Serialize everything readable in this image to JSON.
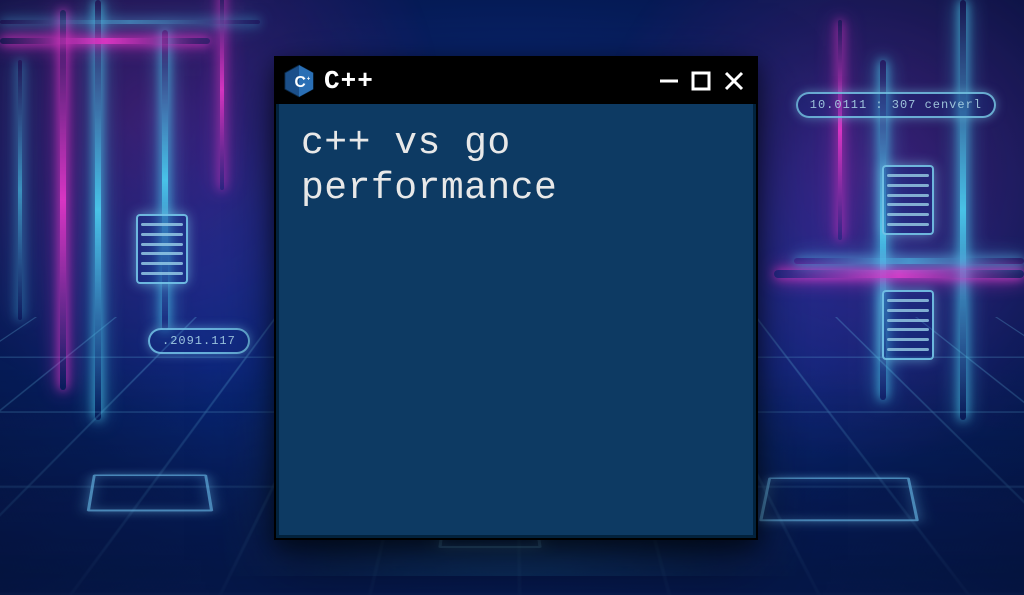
{
  "window": {
    "title": "C++",
    "body_text": "c++ vs go performance"
  },
  "decor": {
    "pill_left": ".2091.117",
    "pill_right": "10.0111 : 307  cenverl"
  },
  "colors": {
    "window_bg": "#0d3a63",
    "titlebar_bg": "#000000",
    "text": "#e8e8e8",
    "neon_cyan": "#55e0ff",
    "neon_pink": "#ff3ad6"
  }
}
